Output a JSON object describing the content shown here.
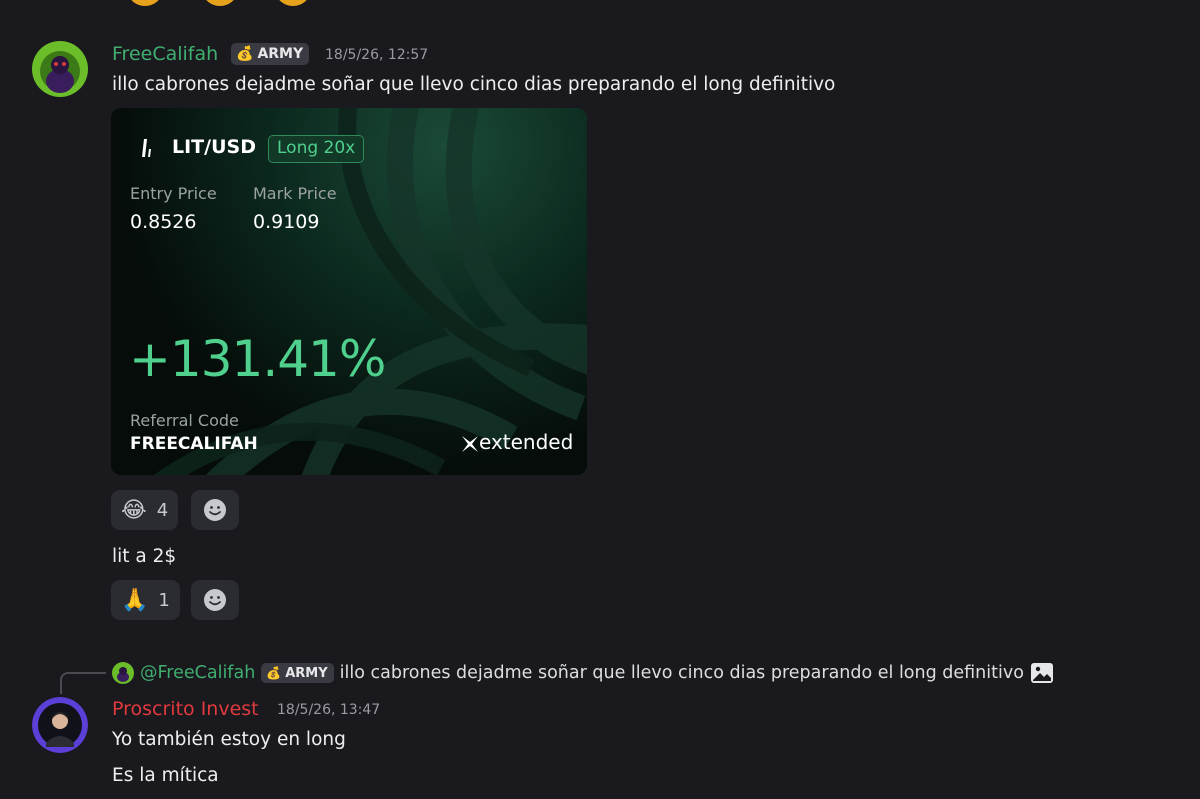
{
  "messages": [
    {
      "author": "FreeCalifah",
      "author_color": "#3fae6f",
      "tag": "ARMY",
      "timestamp": "18/5/26, 12:57",
      "text": "illo cabrones dejadme soñar que llevo cinco dias preparando el long definitivo",
      "attachment": {
        "pair": "LIT/USD",
        "position": "Long 20x",
        "entry_label": "Entry Price",
        "entry_value": "0.8526",
        "mark_label": "Mark Price",
        "mark_value": "0.9109",
        "pnl": "+131.41%",
        "referral_label": "Referral Code",
        "referral_code": "FREECALIFAH",
        "brand": "extended"
      },
      "reactions": [
        {
          "emoji": "😂",
          "count": "4"
        }
      ]
    },
    {
      "text": "lit a 2$",
      "reactions": [
        {
          "emoji": "🙏",
          "count": "1"
        }
      ]
    },
    {
      "reply_to": {
        "mention": "@FreeCalifah",
        "tag": "ARMY",
        "text": "illo cabrones dejadme soñar que llevo cinco dias preparando el long definitivo"
      },
      "author": "Proscrito Invest",
      "author_color": "#e0393e",
      "timestamp": "18/5/26, 13:47",
      "lines": [
        "Yo también estoy en long",
        "Es la mítica"
      ]
    }
  ],
  "icons": {
    "tag_icon": "money-bag-icon",
    "add_reaction": "smiley-icon",
    "reply_attachment": "image-icon"
  },
  "colors": {
    "background": "#1a1a1e",
    "pnl_green": "#4fd08d",
    "badge_green": "#2f8a5c"
  }
}
